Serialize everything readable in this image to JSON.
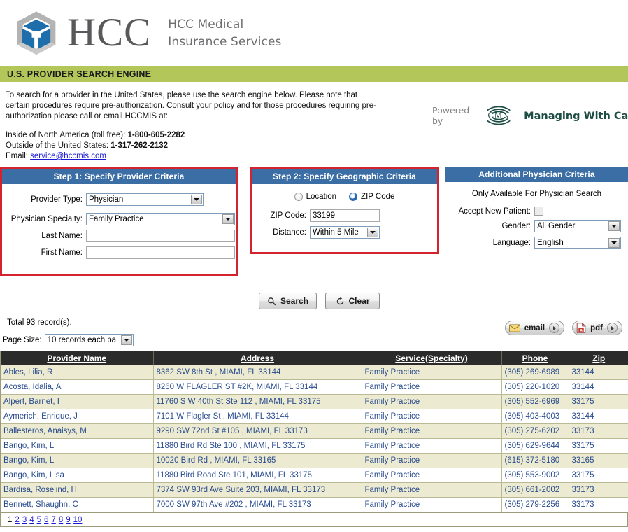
{
  "header": {
    "logo_mark": "hcc-cube-logo",
    "logo_wordmark": "HCC",
    "logo_subtitle_line1": "HCC Medical",
    "logo_subtitle_line2": "Insurance Services"
  },
  "banner": {
    "title": "U.S. PROVIDER SEARCH ENGINE",
    "color": "#b2c65a"
  },
  "intro": {
    "paragraph": "To search for a provider in the United States, please use the search engine below. Please note that certain procedures require pre-authorization. Consult your policy and for those procedures requiring pre-authorization please call or email HCCMIS at:",
    "inside_label": "Inside of North America (toll free): ",
    "inside_value": "1-800-605-2282",
    "outside_label": "Outside of the United States: ",
    "outside_value": "1-317-262-2132",
    "email_label": "Email: ",
    "email_value": "service@hccmis.com"
  },
  "powered_by": {
    "label": "Powered by",
    "mark": "cmn-signal-logo",
    "mark_text": "CMN",
    "brand": "Managing With Care",
    "registered": "®",
    "color": "#1e4d44"
  },
  "step1": {
    "title": "Step 1: Specify Provider Criteria",
    "provider_type_label": "Provider Type:",
    "provider_type_value": "Physician",
    "specialty_label": "Physician Specialty:",
    "specialty_value": "Family Practice",
    "last_name_label": "Last Name:",
    "last_name_value": "",
    "first_name_label": "First Name:",
    "first_name_value": ""
  },
  "step2": {
    "title": "Step 2: Specify Geographic Criteria",
    "radio_location_label": "Location",
    "radio_zip_label": "ZIP Code",
    "selected_radio": "ZIP Code",
    "zip_label": "ZIP Code:",
    "zip_value": "33199",
    "distance_label": "Distance:",
    "distance_value": "Within 5 Mile"
  },
  "additional": {
    "title": "Additional Physician Criteria",
    "note": "Only Available For Physician Search",
    "accept_label": "Accept New Patient:",
    "accept_checked": false,
    "gender_label": "Gender:",
    "gender_value": "All Gender",
    "language_label": "Language:",
    "language_value": "English"
  },
  "actions": {
    "search_label": "Search",
    "search_icon": "magnifier-icon",
    "clear_label": "Clear",
    "clear_icon": "refresh-icon"
  },
  "results": {
    "total_text": "Total 93 record(s).",
    "page_size_label": "Page Size:",
    "page_size_value": "10 records each pa",
    "email_button_label": "email",
    "email_button_icon": "envelope-icon",
    "pdf_button_label": "pdf",
    "pdf_button_icon": "pdf-file-icon",
    "columns": [
      "Provider Name",
      "Address",
      "Service(Specialty)",
      "Phone",
      "Zip"
    ],
    "rows": [
      [
        "Ables, Lilia, R",
        "8362 SW 8th St  , MIAMI, FL 33144",
        "Family Practice",
        "(305) 269-6989",
        "33144"
      ],
      [
        "Acosta, Idalia, A",
        "8260 W FLAGLER ST #2K, MIAMI, FL 33144",
        "Family Practice",
        "(305) 220-1020",
        "33144"
      ],
      [
        "Alpert, Barnet, I",
        "11760 S W 40th St Ste 112  , MIAMI, FL 33175",
        "Family Practice",
        "(305) 552-6969",
        "33175"
      ],
      [
        "Aymerich, Enrique, J",
        "7101 W Flagler St  , MIAMI, FL 33144",
        "Family Practice",
        "(305) 403-4003",
        "33144"
      ],
      [
        "Ballesteros, Anaisys, M",
        "9290 SW 72nd St #105  , MIAMI, FL 33173",
        "Family Practice",
        "(305) 275-6202",
        "33173"
      ],
      [
        "Bango, Kim, L",
        "11880 Bird Rd Ste 100  , MIAMI, FL 33175",
        "Family Practice",
        "(305) 629-9644",
        "33175"
      ],
      [
        "Bango, Kim, L",
        "10020 Bird Rd  , MIAMI, FL 33165",
        "Family Practice",
        "(615) 372-5180",
        "33165"
      ],
      [
        "Bango, Kim, Lisa",
        "11880 Bird Road Ste 101, MIAMI, FL 33175",
        "Family Practice",
        "(305) 553-9002",
        "33175"
      ],
      [
        "Bardisa, Roselind, H",
        "7374 SW 93rd Ave Suite 203, MIAMI, FL 33173",
        "Family Practice",
        "(305) 661-2002",
        "33173"
      ],
      [
        "Bennett, Shaughn, C",
        "7000 SW 97th Ave #202  , MIAMI, FL 33173",
        "Family Practice",
        "(305) 279-2256",
        "33173"
      ]
    ],
    "pages": [
      "1",
      "2",
      "3",
      "4",
      "5",
      "6",
      "7",
      "8",
      "9",
      "10"
    ],
    "current_page": "1"
  }
}
